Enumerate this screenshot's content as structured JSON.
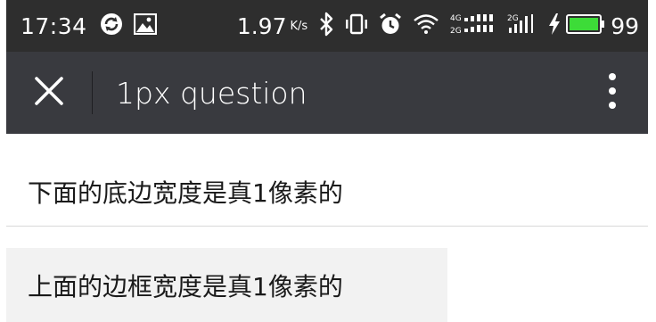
{
  "status_bar": {
    "time": "17:34",
    "speed_value": "1.97",
    "speed_unit": "K/s",
    "battery_level": "99",
    "network_labels": [
      "4G",
      "2G",
      "2G"
    ],
    "icons": [
      "sync-icon",
      "image-icon",
      "bluetooth-icon",
      "vibrate-icon",
      "alarm-icon",
      "wifi-icon",
      "signal-icon",
      "charging-icon",
      "battery-icon"
    ]
  },
  "title_bar": {
    "title": "1px question",
    "close_icon": "close-icon",
    "more_icon": "more-vertical-icon"
  },
  "content": {
    "item_bottom_border": "下面的底边宽度是真1像素的",
    "item_top_border": "上面的边框宽度是真1像素的"
  },
  "colors": {
    "status_bar_bg": "#2e2e2e",
    "title_bar_bg": "#393a3f",
    "battery_green": "#3ddc38",
    "item_bg": "#f2f2f2",
    "divider": "#d8d8d8"
  }
}
